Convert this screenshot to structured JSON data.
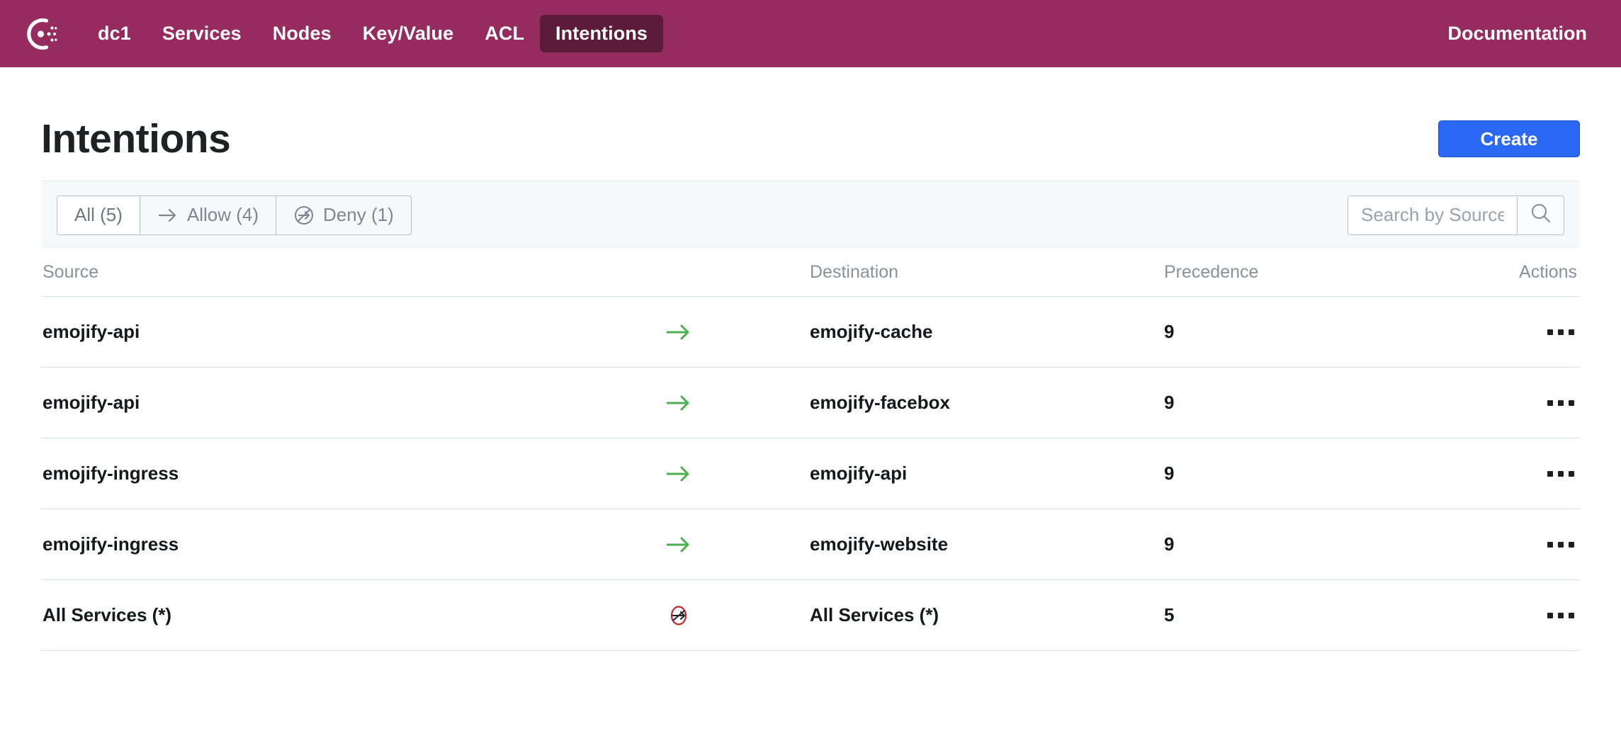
{
  "nav": {
    "logo_icon": "consul-logo-icon",
    "items": [
      {
        "label": "dc1",
        "active": false
      },
      {
        "label": "Services",
        "active": false
      },
      {
        "label": "Nodes",
        "active": false
      },
      {
        "label": "Key/Value",
        "active": false
      },
      {
        "label": "ACL",
        "active": false
      },
      {
        "label": "Intentions",
        "active": true
      }
    ],
    "documentation_label": "Documentation",
    "background_color": "#952b5e",
    "active_background_color": "#5c1b39"
  },
  "header": {
    "title": "Intentions",
    "create_label": "Create",
    "create_color": "#2a68f5"
  },
  "toolbar": {
    "filters": [
      {
        "label": "All (5)",
        "icon": "none",
        "active": true
      },
      {
        "label": "Allow (4)",
        "icon": "arrow-right-icon",
        "active": false
      },
      {
        "label": "Deny (1)",
        "icon": "deny-arrow-icon",
        "active": false
      }
    ],
    "search": {
      "value": "",
      "placeholder": "Search by Source or",
      "icon": "search-icon"
    }
  },
  "table": {
    "columns": [
      "Source",
      "Destination",
      "Precedence",
      "Actions"
    ],
    "action_icon": "more-horizontal-icon",
    "allow_color": "#4caf50",
    "deny_color": "#c0272d",
    "rows": [
      {
        "source": "emojify-api",
        "action": "allow",
        "destination": "emojify-cache",
        "precedence": "9"
      },
      {
        "source": "emojify-api",
        "action": "allow",
        "destination": "emojify-facebox",
        "precedence": "9"
      },
      {
        "source": "emojify-ingress",
        "action": "allow",
        "destination": "emojify-api",
        "precedence": "9"
      },
      {
        "source": "emojify-ingress",
        "action": "allow",
        "destination": "emojify-website",
        "precedence": "9"
      },
      {
        "source": "All Services (*)",
        "action": "deny",
        "destination": "All Services (*)",
        "precedence": "5"
      }
    ]
  }
}
